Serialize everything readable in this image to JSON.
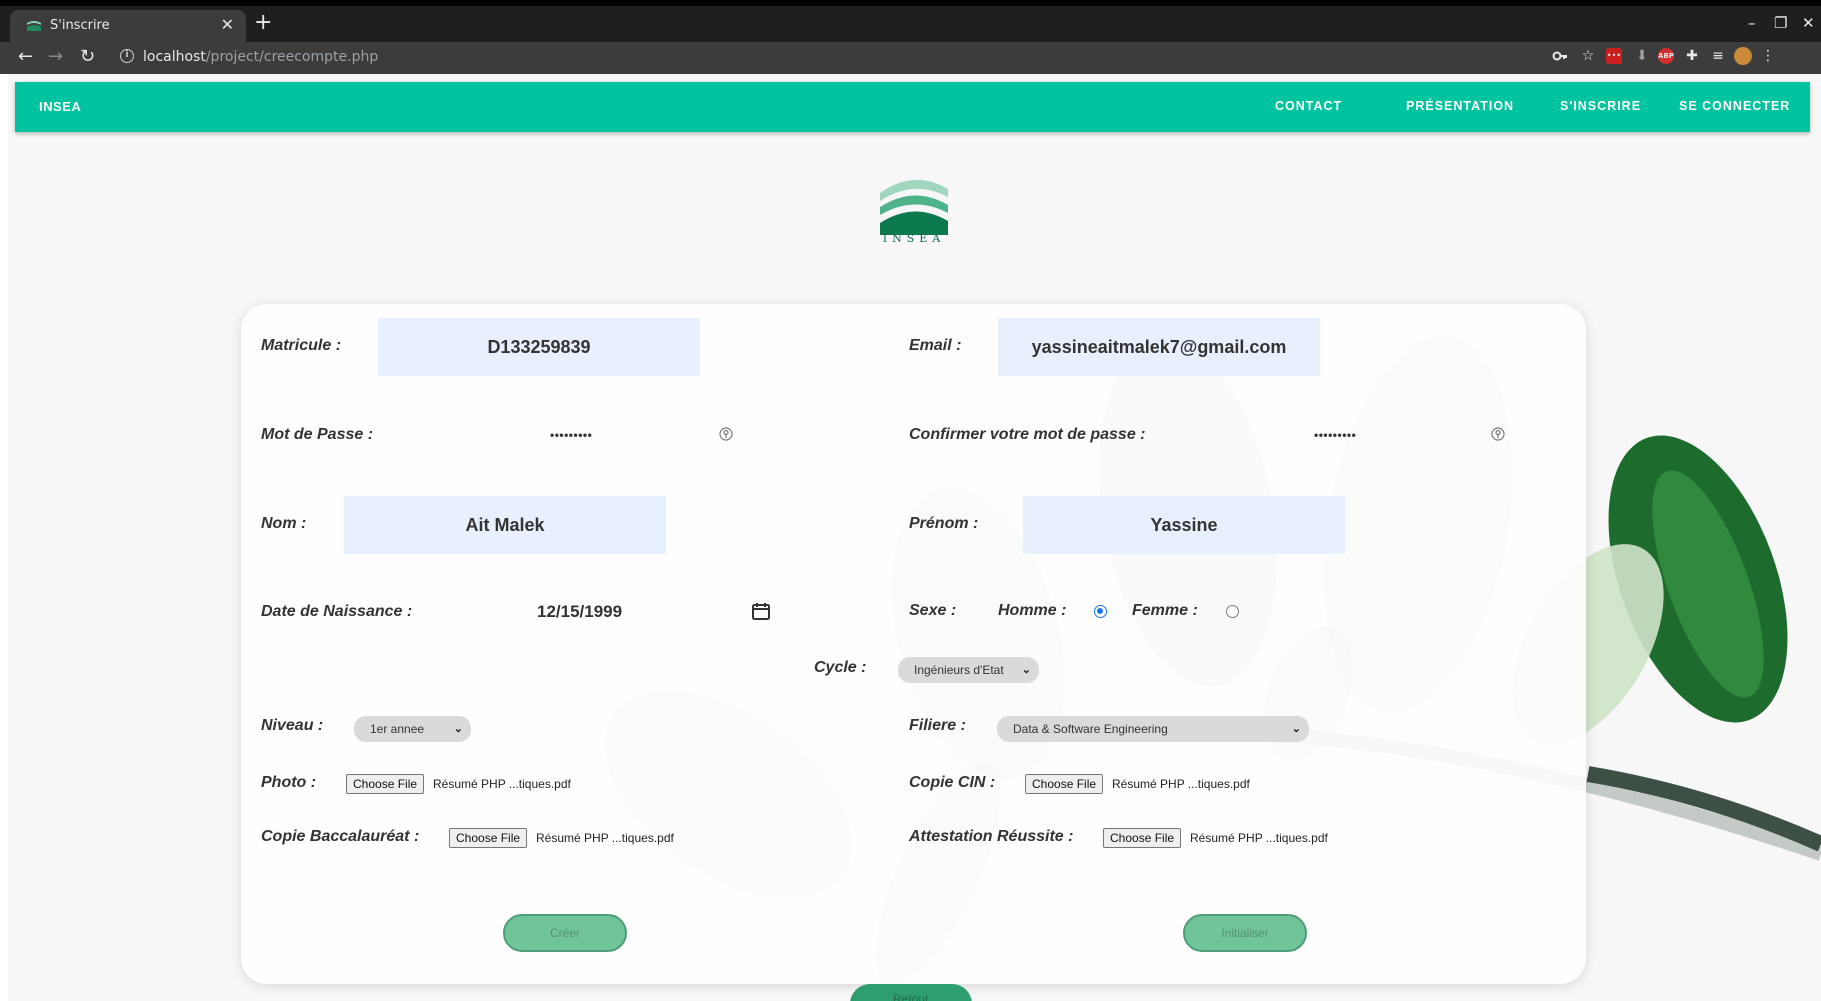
{
  "browser": {
    "tab_title": "S'inscrire",
    "tab_close": "✕",
    "new_tab": "+",
    "url_host": "localhost",
    "url_path": "/project/creecompte.php",
    "window_controls": {
      "minimize": "–",
      "restore": "❐",
      "close": "✕"
    },
    "icons": [
      "back-icon",
      "forward-icon",
      "reload-icon",
      "info-icon",
      "key-icon",
      "star-icon",
      "extension-lastpass-icon",
      "download-icon",
      "adblock-icon",
      "puzzle-icon",
      "media-icon",
      "profile-avatar",
      "menu-icon"
    ]
  },
  "navbar": {
    "brand": "INSEA",
    "links": [
      "CONTACT",
      "PRÉSENTATION",
      "S'INSCRIRE",
      "SE CONNECTER"
    ]
  },
  "logo": {
    "text": "INSEA"
  },
  "form": {
    "matricule": {
      "label": "Matricule :",
      "value": "D133259839"
    },
    "email": {
      "label": "Email :",
      "value": "yassineaitmalek7@gmail.com"
    },
    "password": {
      "label": "Mot de Passe :",
      "value": "•••••••••"
    },
    "confirm_password": {
      "label": "Confirmer votre mot de passe :",
      "value": "•••••••••"
    },
    "nom": {
      "label": "Nom :",
      "value": "Ait Malek"
    },
    "prenom": {
      "label": "Prénom :",
      "value": "Yassine"
    },
    "date_naissance": {
      "label": "Date de Naissance :",
      "value": "12/15/1999"
    },
    "sexe": {
      "label": "Sexe :",
      "homme": "Homme :",
      "femme": "Femme :",
      "selected": "Homme"
    },
    "cycle": {
      "label": "Cycle :",
      "value": "Ingénieurs d'Etat"
    },
    "niveau": {
      "label": "Niveau :",
      "value": "1er annee"
    },
    "filiere": {
      "label": "Filiere :",
      "value": "Data & Software Engineering"
    },
    "photo": {
      "label": "Photo :",
      "button": "Choose File",
      "file": "Résumé PHP ...tiques.pdf"
    },
    "copie_cin": {
      "label": "Copie CIN :",
      "button": "Choose File",
      "file": "Résumé PHP ...tiques.pdf"
    },
    "copie_bac": {
      "label": "Copie Baccalauréat :",
      "button": "Choose File",
      "file": "Résumé PHP ...tiques.pdf"
    },
    "attestation": {
      "label": "Attestation Réussite :",
      "button": "Choose File",
      "file": "Résumé PHP ...tiques.pdf"
    },
    "buttons": {
      "create": "Créer",
      "reset": "Initialiser",
      "bottom": "Retour"
    }
  },
  "colors": {
    "navbar": "#00c3a0",
    "accent_button": "#6fc49a",
    "input_fill": "#e8f0fe",
    "radio_checked": "#1a73e8"
  }
}
